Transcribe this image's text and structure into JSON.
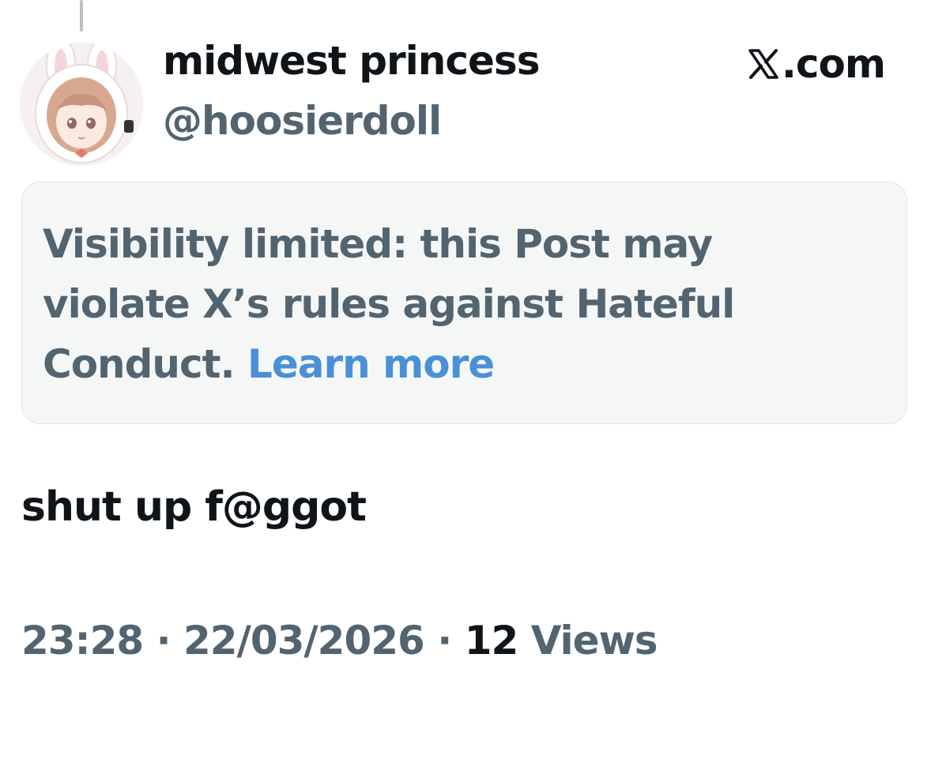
{
  "post": {
    "display_name": "midwest princess",
    "handle": "@hoosierdoll",
    "source_site": ".com",
    "notice_text": "Visibility limited: this Post may violate X’s rules against Hateful Conduct.",
    "notice_link": "Learn more",
    "body": "shut up f@ggot",
    "time": "23:28",
    "date": "22/03/2026",
    "separator": "·",
    "views_count": "12",
    "views_label": "Views"
  },
  "icons": {
    "avatar": "anime-avatar-image",
    "site_logo": "x-logo-icon"
  },
  "colors": {
    "primary_text": "#0f1419",
    "secondary_text": "#536471",
    "link": "#4a90d6",
    "notice_bg": "#f5f7f7"
  }
}
